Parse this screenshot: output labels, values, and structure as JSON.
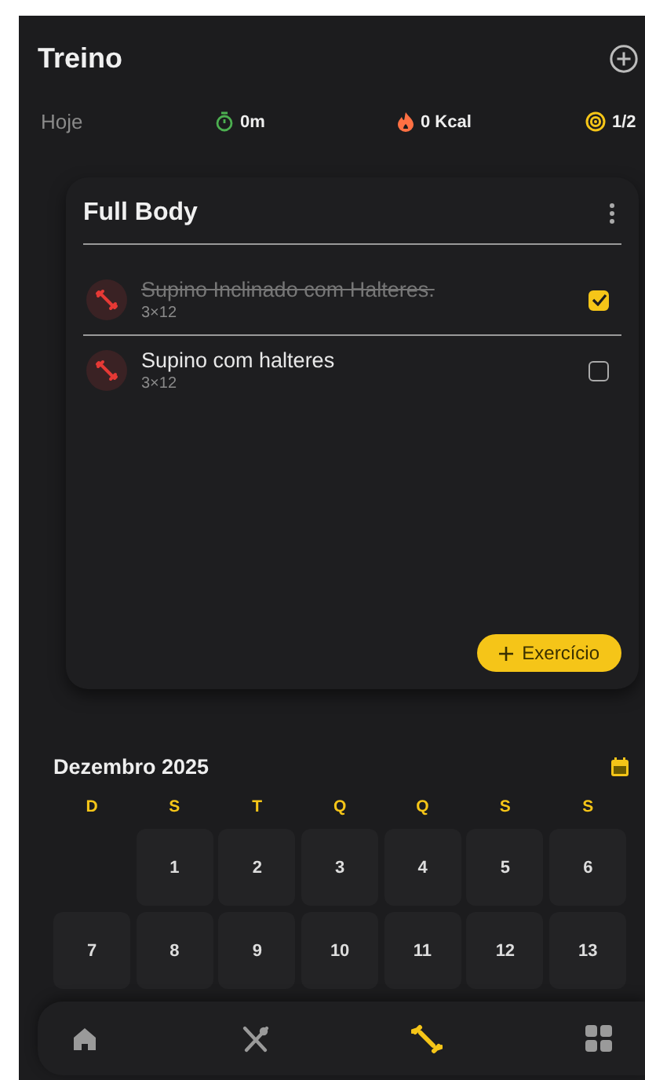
{
  "header": {
    "title": "Treino"
  },
  "stats": {
    "label": "Hoje",
    "items": [
      {
        "kind": "timer",
        "value": "0m",
        "color": "#4caf50"
      },
      {
        "kind": "fire",
        "value": "0 Kcal",
        "color": "#ff7043"
      },
      {
        "kind": "target",
        "value": "1/2",
        "color": "#f5c518"
      }
    ]
  },
  "workout": {
    "title": "Full Body",
    "exercises": [
      {
        "name": "Supino Inclinado com Halteres.",
        "sets": "3×12",
        "checked": true
      },
      {
        "name": "Supino com halteres",
        "sets": "3×12",
        "checked": false
      }
    ],
    "add_button": "Exercício"
  },
  "calendar": {
    "title": "Dezembro 2025",
    "weekdays": [
      "D",
      "S",
      "T",
      "Q",
      "Q",
      "S",
      "S"
    ],
    "weeks": [
      {
        "kind": "partial",
        "days": [
          "1",
          "2",
          "3",
          "4",
          "5",
          "6"
        ]
      },
      {
        "kind": "full",
        "days": [
          "7",
          "8",
          "9",
          "10",
          "11",
          "12",
          "13"
        ]
      }
    ]
  },
  "nav": [
    {
      "kind": "home",
      "selected": false
    },
    {
      "kind": "food",
      "selected": false
    },
    {
      "kind": "workout",
      "selected": true
    },
    {
      "kind": "apps",
      "selected": false
    }
  ]
}
